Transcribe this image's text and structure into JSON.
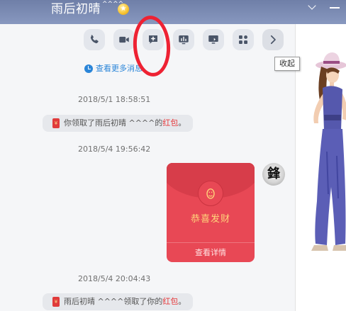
{
  "header": {
    "contact_name": "雨后初晴",
    "name_suffix": "^^^^",
    "vip_badge": "★"
  },
  "toolbar": {
    "buttons": [
      {
        "name": "voice-call",
        "icon": "phone-icon"
      },
      {
        "name": "video-call",
        "icon": "video-camera-icon"
      },
      {
        "name": "send-message",
        "icon": "message-add-icon"
      },
      {
        "name": "screen-share",
        "icon": "chart-bars-icon"
      },
      {
        "name": "remote-desktop",
        "icon": "monitor-icon"
      },
      {
        "name": "apps",
        "icon": "apps-grid-icon"
      },
      {
        "name": "expand",
        "icon": "chevron-right-icon"
      }
    ],
    "tooltip": "收起"
  },
  "chat": {
    "more_messages_link": "查看更多消息",
    "timestamps": [
      "2018/5/1 18:58:51",
      "2018/5/4 19:56:42",
      "2018/5/4 20:04:43"
    ],
    "sys_msg_1": {
      "prefix": "你领取了雨后初晴 ^^^^的",
      "highlight": "红包",
      "suffix": "。"
    },
    "sys_msg_2": {
      "prefix": "雨后初晴 ^^^^领取了你的",
      "highlight": "红包",
      "suffix": "。"
    },
    "red_packet": {
      "greeting": "恭喜发财",
      "detail_link": "查看详情"
    },
    "avatar_glyph": "鋒"
  },
  "colors": {
    "titlebar": "#7a8ab3",
    "red_packet": "#e84855",
    "highlight_ring": "#ee2233",
    "link": "#2a85d8"
  }
}
